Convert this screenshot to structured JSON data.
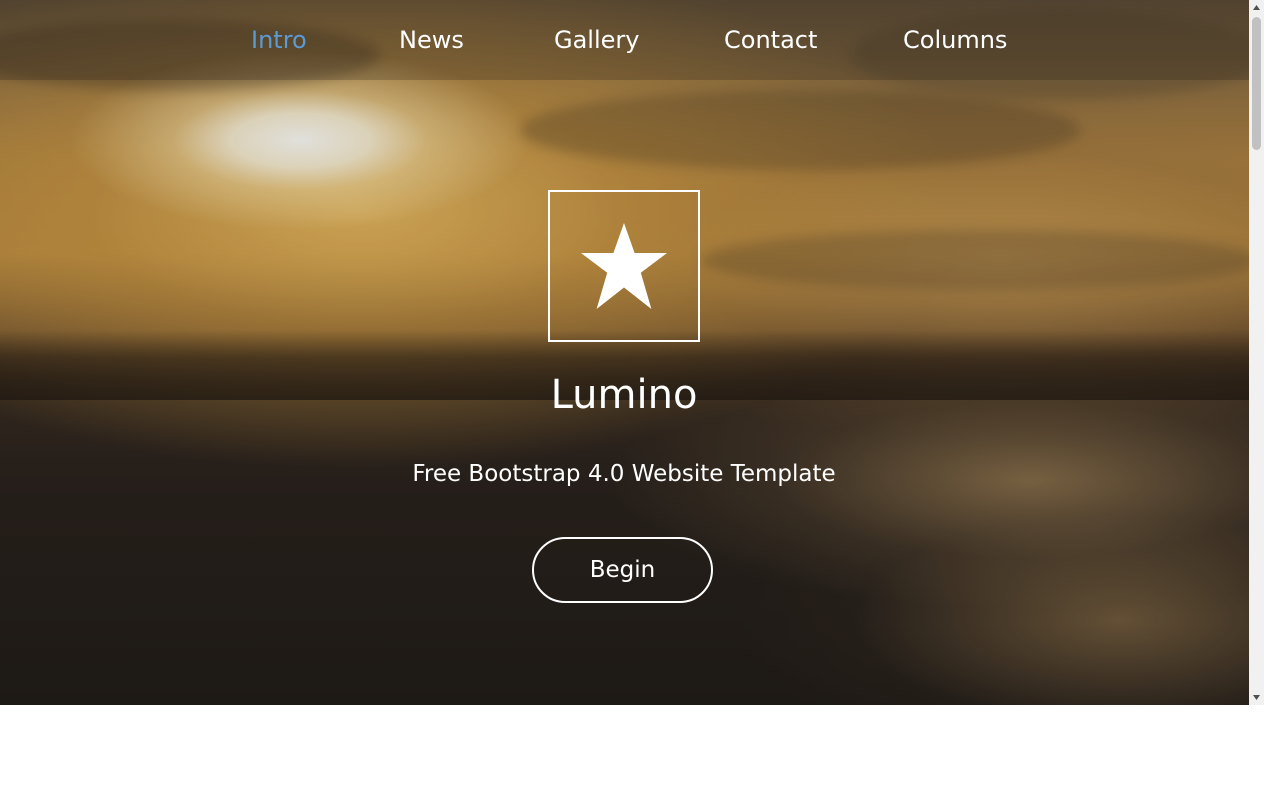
{
  "nav": {
    "items": [
      {
        "label": "Intro",
        "active": true
      },
      {
        "label": "News",
        "active": false
      },
      {
        "label": "Gallery",
        "active": false
      },
      {
        "label": "Contact",
        "active": false
      },
      {
        "label": "Columns",
        "active": false
      }
    ]
  },
  "hero": {
    "logo_icon": "star-icon",
    "title": "Lumino",
    "tagline": "Free Bootstrap 4.0 Website Template",
    "button_label": "Begin",
    "background": "blurred sunset beach photo"
  },
  "colors": {
    "nav_active": "#5b9bd5",
    "text": "#ffffff"
  }
}
